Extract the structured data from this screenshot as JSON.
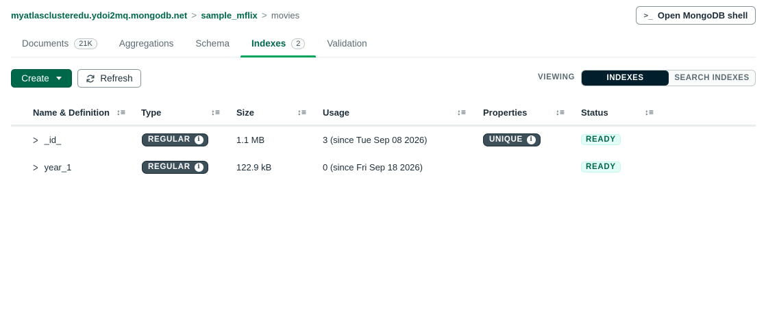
{
  "breadcrumb": {
    "cluster": "myatlasclusteredu.ydoi2mq.mongodb.net",
    "database": "sample_mflix",
    "collection": "movies",
    "separator": ">"
  },
  "shell_button": {
    "icon": ">_",
    "label": "Open MongoDB shell"
  },
  "tabs": [
    {
      "label": "Documents",
      "count": "21K",
      "active": false
    },
    {
      "label": "Aggregations",
      "count": "",
      "active": false
    },
    {
      "label": "Schema",
      "count": "",
      "active": false
    },
    {
      "label": "Indexes",
      "count": "2",
      "active": true
    },
    {
      "label": "Validation",
      "count": "",
      "active": false
    }
  ],
  "toolbar": {
    "create_label": "Create",
    "refresh_label": "Refresh",
    "viewing_label": "VIEWING",
    "view_options": [
      "INDEXES",
      "SEARCH INDEXES"
    ],
    "selected_view": "INDEXES"
  },
  "table": {
    "columns": [
      "Name & Definition",
      "Type",
      "Size",
      "Usage",
      "Properties",
      "Status"
    ],
    "sort_icon": "↕≡",
    "rows": [
      {
        "name": "_id_",
        "type": "REGULAR",
        "size": "1.1 MB",
        "usage": "3 (since Tue Sep 08 2026)",
        "properties": "UNIQUE",
        "status": "READY"
      },
      {
        "name": "year_1",
        "type": "REGULAR",
        "size": "122.9 kB",
        "usage": "0 (since Fri Sep 18 2026)",
        "properties": "",
        "status": "READY"
      }
    ]
  },
  "colors": {
    "accent": "#00684a",
    "tab_underline": "#00a35c",
    "segment_selected": "#001e2b",
    "pill": "#3d4f58"
  }
}
